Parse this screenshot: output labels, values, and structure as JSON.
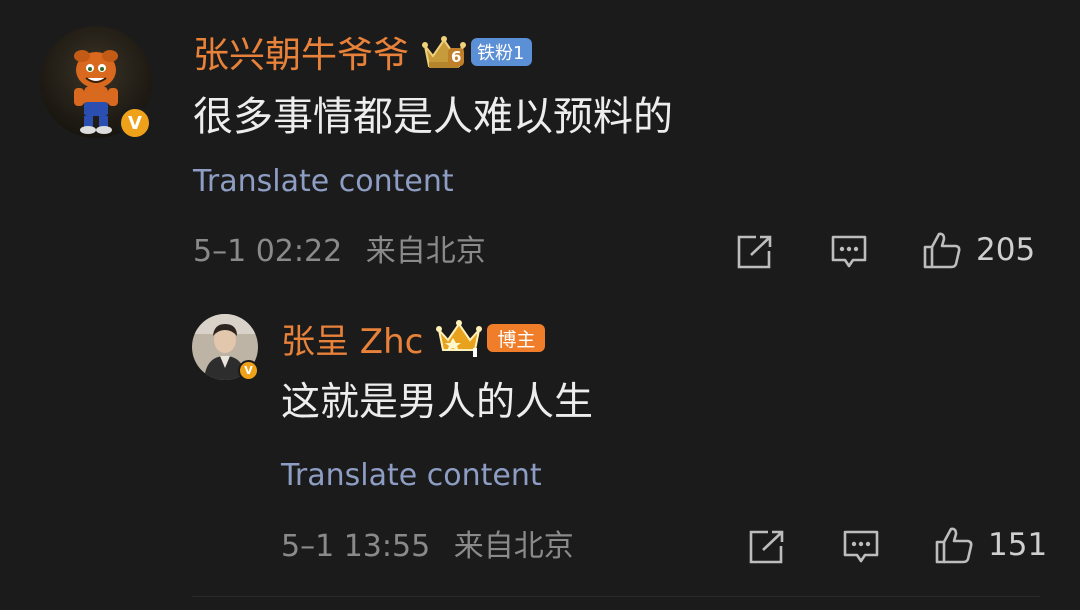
{
  "comment": {
    "username": "张兴朝牛爷爷",
    "fan_badge": "铁粉1",
    "fan_level": "6",
    "verified_mark": "V",
    "text": "很多事情都是人难以预料的",
    "translate_label": "Translate content",
    "timestamp": "5–1 02:22",
    "location": "来自北京",
    "likes": "205",
    "icons": [
      "share-icon",
      "comment-icon",
      "like-icon"
    ]
  },
  "reply": {
    "username": "张呈 Zhc",
    "role_badge": "博主",
    "verified_mark": "V",
    "text": "这就是男人的人生",
    "translate_label": "Translate content",
    "timestamp": "5–1 13:55",
    "location": "来自北京",
    "likes": "151",
    "icons": [
      "share-icon",
      "comment-icon",
      "like-icon"
    ]
  },
  "colors": {
    "background": "#1b1b1b",
    "username": "#e8823a",
    "translate_link": "#8d9dc4",
    "meta": "#8a8a8a",
    "fan_badge": "#5b8fd6",
    "blogger_badge": "#ef7d2a",
    "verified": "#f0a11a"
  }
}
